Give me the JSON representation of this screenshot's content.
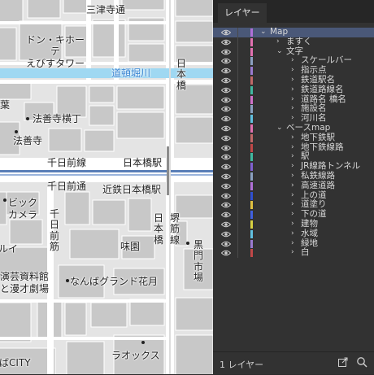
{
  "map": {
    "labels": {
      "sanzu_dori": "三津寺通",
      "don_quijote": "ドン・キホーテ\nえびすタワー",
      "dotonbori_river": "道頓堀川",
      "nipponbashi_top": "日本橋",
      "hozenji_yokocho": "法善寺横丁",
      "hozenji": "法善寺",
      "sennichimae_sen": "千日前線",
      "nipponbashi_eki": "日本橋駅",
      "sennichimae_dori": "千日前通",
      "kintetsu_nipponbashi": "近鉄日本橋駅",
      "bic_camera": "ビック\nカメラ",
      "sennichimae_v": "千日前筋",
      "nipponbashi_v": "日本橋",
      "sakaisuji": "堺筋線",
      "kuromon_ichiba": "黒門市場",
      "mien": "味園",
      "geino_shiryokan": "演芸資料館\nと漫才劇場",
      "namba_grand_kagetsu": "なんばグランド花月",
      "laox": "ラオックス",
      "namba_city": "ばCITY",
      "partial_ka": "葉",
      "partial_marui": "ルイ"
    }
  },
  "panel": {
    "tab_label": "レイヤー",
    "footer_text": "1 レイヤー",
    "layers": [
      {
        "label": "Map",
        "level": 0,
        "expanded": true,
        "selected": true,
        "color": "#b070d8"
      },
      {
        "label": "ますく",
        "level": 1,
        "expanded": false,
        "color": "#e070b0"
      },
      {
        "label": "文字",
        "level": 1,
        "expanded": true,
        "color": "#e070b0"
      },
      {
        "label": "スケールバー",
        "level": 2,
        "expanded": false,
        "color": "#8aa0c0"
      },
      {
        "label": "指示点",
        "level": 2,
        "expanded": false,
        "color": "#9a7ad0"
      },
      {
        "label": "鉄道駅名",
        "level": 2,
        "expanded": false,
        "color": "#c06868"
      },
      {
        "label": "鉄道路線名",
        "level": 2,
        "expanded": false,
        "color": "#40b8a0"
      },
      {
        "label": "道路名 橋名",
        "level": 2,
        "expanded": false,
        "color": "#d070c8"
      },
      {
        "label": "施設名",
        "level": 2,
        "expanded": false,
        "color": "#8aa0c0"
      },
      {
        "label": "河川名",
        "level": 2,
        "expanded": false,
        "color": "#60c0e0"
      },
      {
        "label": "ベースmap",
        "level": 1,
        "expanded": true,
        "color": "#e070b0"
      },
      {
        "label": "地下鉄駅",
        "level": 2,
        "expanded": false,
        "color": "#c06868"
      },
      {
        "label": "地下鉄線路",
        "level": 2,
        "expanded": false,
        "color": "#c04848"
      },
      {
        "label": "駅",
        "level": 2,
        "expanded": false,
        "color": "#40b8a0"
      },
      {
        "label": "JR線路トンネル",
        "level": 2,
        "expanded": false,
        "color": "#8060d0"
      },
      {
        "label": "私鉄線路",
        "level": 2,
        "expanded": false,
        "color": "#8aa0c0"
      },
      {
        "label": "高速道路",
        "level": 2,
        "expanded": false,
        "color": "#b070d8"
      },
      {
        "label": "上の道",
        "level": 2,
        "expanded": false,
        "color": "#3050d0"
      },
      {
        "label": "道塗り",
        "level": 2,
        "expanded": false,
        "color": "#e0c040"
      },
      {
        "label": "下の道",
        "level": 2,
        "expanded": false,
        "color": "#4060e0"
      },
      {
        "label": "建物",
        "level": 2,
        "expanded": false,
        "color": "#d8d040"
      },
      {
        "label": "水域",
        "level": 2,
        "expanded": false,
        "color": "#60c0e0"
      },
      {
        "label": "緑地",
        "level": 2,
        "expanded": false,
        "color": "#9a7ad0"
      },
      {
        "label": "白",
        "level": 2,
        "expanded": false,
        "color": "#c04848"
      }
    ]
  }
}
